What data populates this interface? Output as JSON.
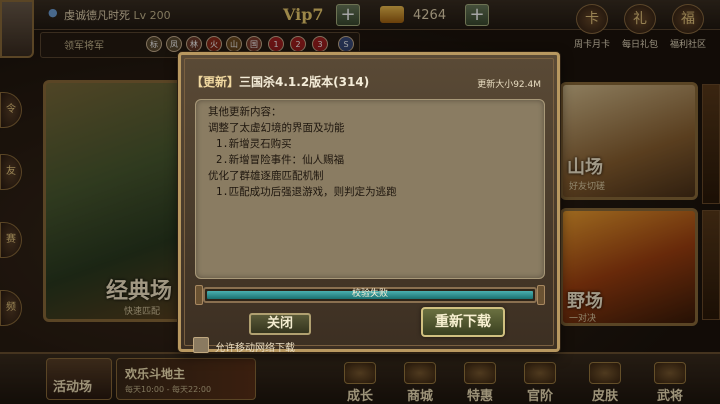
{
  "player": {
    "name": "虔诚德凡时死",
    "level": "Lv 200"
  },
  "vip": "Vip7",
  "gold": "4264",
  "top_icons": [
    "周卡月卡",
    "每日礼包",
    "福利社区"
  ],
  "rank": {
    "label": "领军将军",
    "badges": [
      "标",
      "凤",
      "林",
      "火",
      "山",
      "国",
      "1",
      "2",
      "3",
      "S"
    ]
  },
  "cards": {
    "left": {
      "title": "经典场",
      "sub": "快速匹配"
    },
    "right1": {
      "title": "山场",
      "sub": "好友切磋"
    },
    "right2": {
      "title": "野场",
      "sub": "一对决"
    }
  },
  "bottom": {
    "activity": "活动场",
    "event_title": "欢乐斗地主",
    "event_sub": "每天10:00 - 每天22:00",
    "buttons": [
      "成长",
      "商城",
      "特惠",
      "官阶",
      "皮肤",
      "武将"
    ]
  },
  "dialog": {
    "title_tag": "【更新】",
    "title_text": "三国杀4.1.2版本(314)",
    "size": "更新大小92.4M",
    "notes": [
      "其他更新内容：",
      "调整了太虚幻境的界面及功能",
      "  1.新增灵石购买",
      "  2.新增冒险事件：仙人赐福",
      "优化了群雄逐鹿匹配机制",
      "  1.匹配成功后强退游戏，则判定为逃跑"
    ],
    "progress_text": "校验失败",
    "progress_value": 1.0,
    "close_label": "关闭",
    "redownload_label": "重新下载",
    "mobile_checkbox_label": "允许移动网络下载"
  },
  "colors": {
    "accent": "#b89860",
    "progress": "#2a9090"
  }
}
